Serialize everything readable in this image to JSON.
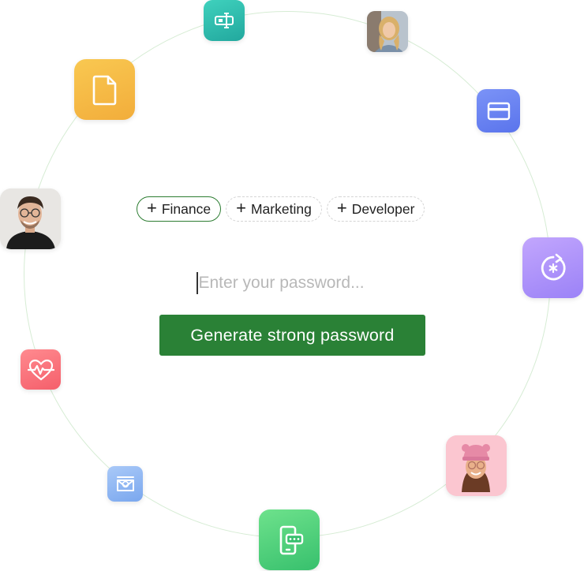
{
  "tags": [
    {
      "label": "Finance",
      "active": true
    },
    {
      "label": "Marketing",
      "active": false
    },
    {
      "label": "Developer",
      "active": false
    }
  ],
  "password_input": {
    "placeholder": "Enter your password...",
    "value": ""
  },
  "generate_button": {
    "label": "Generate strong password"
  },
  "orbit_icons": [
    {
      "name": "text-field-icon",
      "color": "#2fbfb0"
    },
    {
      "name": "document-icon",
      "color": "#f5b840"
    },
    {
      "name": "credit-card-icon",
      "color": "#6d86f2"
    },
    {
      "name": "password-reset-icon",
      "color": "#a78bfa"
    },
    {
      "name": "heartbeat-icon",
      "color": "#fb6f78"
    },
    {
      "name": "mail-icon",
      "color": "#8eb8f4"
    },
    {
      "name": "phone-otp-icon",
      "color": "#4ccf78"
    }
  ],
  "avatars": [
    {
      "name": "avatar-woman-blonde"
    },
    {
      "name": "avatar-man-glasses"
    },
    {
      "name": "avatar-memoji-pink-hat"
    }
  ]
}
